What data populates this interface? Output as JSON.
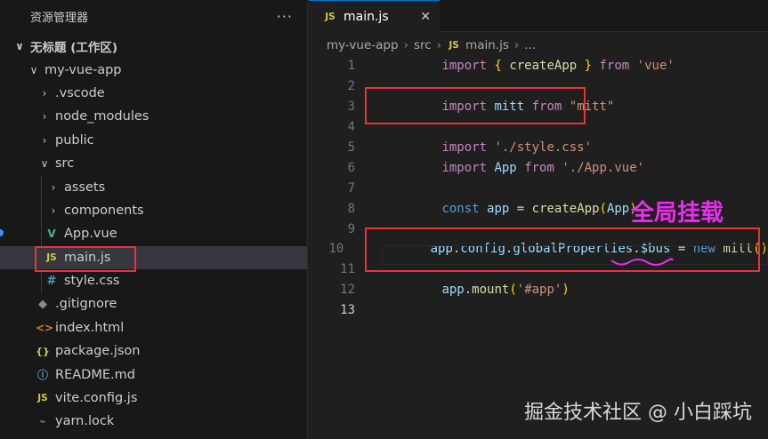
{
  "explorer": {
    "title": "资源管理器",
    "more": "···",
    "workspace": "无标题 (工作区)",
    "items": [
      {
        "label": "my-vue-app",
        "chev": "∨",
        "icon": ""
      },
      {
        "label": ".vscode",
        "chev": "›",
        "icon": ""
      },
      {
        "label": "node_modules",
        "chev": "›",
        "icon": ""
      },
      {
        "label": "public",
        "chev": "›",
        "icon": ""
      },
      {
        "label": "src",
        "chev": "∨",
        "icon": ""
      },
      {
        "label": "assets",
        "chev": "›",
        "icon": ""
      },
      {
        "label": "components",
        "chev": "›",
        "icon": ""
      },
      {
        "label": "App.vue",
        "icon": "V"
      },
      {
        "label": "main.js",
        "icon": "JS"
      },
      {
        "label": "style.css",
        "icon": "#"
      },
      {
        "label": ".gitignore",
        "icon": "◆"
      },
      {
        "label": "index.html",
        "icon": "<>"
      },
      {
        "label": "package.json",
        "icon": "{}"
      },
      {
        "label": "README.md",
        "icon": "ⓘ"
      },
      {
        "label": "vite.config.js",
        "icon": "JS"
      },
      {
        "label": "yarn.lock",
        "icon": "⌁"
      }
    ]
  },
  "tab": {
    "icon": "JS",
    "label": "main.js",
    "close": "✕"
  },
  "breadcrumb": [
    "my-vue-app",
    "src",
    "main.js",
    "..."
  ],
  "breadcrumb_icon": "JS",
  "line_numbers": [
    "1",
    "2",
    "3",
    "4",
    "5",
    "6",
    "7",
    "8",
    "9",
    "10",
    "11",
    "12",
    "13"
  ],
  "code": {
    "l1": {
      "kw": "import",
      "b1": "{",
      "fn": "createApp",
      "b2": "}",
      "from": "from",
      "str": "'vue'"
    },
    "l3": {
      "kw": "import",
      "var": "mitt",
      "from": "from",
      "str": "\"mitt\""
    },
    "l5": {
      "kw": "import",
      "str": "'./style.css'"
    },
    "l6": {
      "kw": "import",
      "var": "App",
      "from": "from",
      "str": "'./App.vue'"
    },
    "l8": {
      "kw": "const",
      "var": "app",
      "eq": "=",
      "fn": "createApp",
      "p1": "(",
      "arg": "App",
      "p2": ")"
    },
    "l10": {
      "obj": "app",
      "d1": ".",
      "p1": "config",
      "d2": ".",
      "p2": "globalProperties",
      "d3": ".",
      "p3": "$bus",
      "eq": "=",
      "kw": "new",
      "fn": "mitt",
      "paren": "()"
    },
    "l12": {
      "obj": "app",
      "d": ".",
      "fn": "mount",
      "p1": "(",
      "str": "'#app'",
      "p2": ")"
    }
  },
  "annotation": "全局挂载",
  "watermark": "掘金技术社区 @ 小白踩坑",
  "colors": {
    "highlight": "#e8333a",
    "annotation": "#ea2cf0",
    "accent": "#0078d4"
  }
}
